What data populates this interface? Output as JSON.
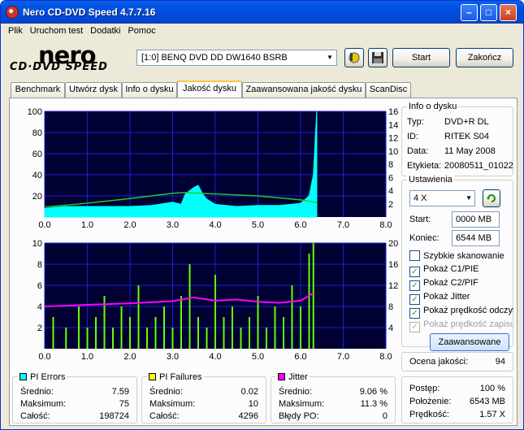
{
  "window": {
    "title": "Nero CD-DVD Speed 4.7.7.16"
  },
  "menu": [
    "Plik",
    "Uruchom test",
    "Dodatki",
    "Pomoc"
  ],
  "logo": {
    "brand": "nero",
    "product": "CD·DVD SPEED"
  },
  "drive": {
    "selected": "[1:0]  BENQ DVD DD DW1640 BSRB"
  },
  "buttons": {
    "start": "Start",
    "end": "Zakończ",
    "advanced": "Zaawansowane"
  },
  "tabs": [
    "Benchmark",
    "Utwórz dysk",
    "Info o dysku",
    "Jakość dysku",
    "Zaawansowana jakość dysku",
    "ScanDisc"
  ],
  "active_tab": "Jakość dysku",
  "disc_info": {
    "legend": "Info o dysku",
    "type_label": "Typ:",
    "type": "DVD+R DL",
    "id_label": "ID:",
    "id": "RITEK S04",
    "date_label": "Data:",
    "date": "11 May 2008",
    "label_label": "Etykieta:",
    "label": "20080511_01022"
  },
  "settings": {
    "legend": "Ustawienia",
    "speed": "4 X",
    "start_label": "Start:",
    "start": "0000 MB",
    "end_label": "Koniec:",
    "end": "6544 MB",
    "checks": [
      {
        "label": "Szybkie skanowanie",
        "checked": false,
        "enabled": true
      },
      {
        "label": "Pokaż C1/PIE",
        "checked": true,
        "enabled": true
      },
      {
        "label": "Pokaż C2/PIF",
        "checked": true,
        "enabled": true
      },
      {
        "label": "Pokaż Jitter",
        "checked": true,
        "enabled": true
      },
      {
        "label": "Pokaż prędkość odczytu",
        "checked": true,
        "enabled": true
      },
      {
        "label": "Pokaż prędkość zapisu",
        "checked": true,
        "enabled": false
      }
    ]
  },
  "quality": {
    "label": "Ocena jakości:",
    "value": "94"
  },
  "progress": {
    "progress_label": "Postęp:",
    "progress": "100 %",
    "position_label": "Położenie:",
    "position": "6543 MB",
    "speed_label": "Prędkość:",
    "speed": "1.57 X"
  },
  "stats": {
    "pi_errors": {
      "title": "PI Errors",
      "avg_label": "Średnio:",
      "avg": "7.59",
      "max_label": "Maksimum:",
      "max": "75",
      "total_label": "Całość:",
      "total": "198724"
    },
    "pi_failures": {
      "title": "PI Failures",
      "avg_label": "Średnio:",
      "avg": "0.02",
      "max_label": "Maksimum:",
      "max": "10",
      "total_label": "Całość:",
      "total": "4296"
    },
    "jitter": {
      "title": "Jitter",
      "avg_label": "Średnio:",
      "avg": "9.06 %",
      "max_label": "Maksimum:",
      "max": "11.3 %",
      "po_label": "Błędy PO:",
      "po": "0"
    }
  },
  "colors": {
    "pie": "#00ffff",
    "pif": "#ffff00",
    "jitter": "#ff00ff",
    "speed": "#22cc22",
    "pif_bars": "#66ff00",
    "plot_bg": "#000033",
    "grid": "#1d1dd8"
  },
  "chart_data": [
    {
      "type": "area",
      "title": "PI Errors",
      "x_ticks": [
        "0.0",
        "1.0",
        "2.0",
        "3.0",
        "4.0",
        "5.0",
        "6.0",
        "7.0",
        "8.0"
      ],
      "y_left_ticks": [
        "20",
        "40",
        "60",
        "80",
        "100"
      ],
      "y_right_ticks": [
        "2",
        "4",
        "6",
        "8",
        "10",
        "12",
        "14",
        "16"
      ],
      "xlim": [
        0,
        8
      ],
      "ylim": [
        0,
        100
      ],
      "y2lim": [
        0,
        16
      ],
      "series": [
        {
          "values_x": [
            0,
            0.2,
            0.5,
            1.0,
            1.5,
            2.0,
            2.5,
            3.0,
            3.2,
            3.3,
            3.4,
            3.5,
            3.6,
            3.7,
            3.8,
            4.0,
            4.5,
            5.0,
            5.5,
            6.0,
            6.2,
            6.3,
            6.35,
            6.38
          ],
          "values": [
            8,
            9,
            10,
            10,
            10,
            10,
            11,
            14,
            12,
            22,
            25,
            28,
            30,
            22,
            17,
            12,
            10,
            11,
            11,
            13,
            20,
            40,
            80,
            100
          ]
        },
        {
          "values_x": [
            0,
            1,
            2,
            3,
            3.3,
            4,
            5,
            6,
            6.38
          ],
          "values": [
            1.5,
            2.1,
            2.8,
            3.6,
            3.7,
            3.5,
            3.2,
            2.6,
            2.2
          ]
        }
      ]
    },
    {
      "type": "bar",
      "title": "PI Failures",
      "x_ticks": [
        "0.0",
        "1.0",
        "2.0",
        "3.0",
        "4.0",
        "5.0",
        "6.0",
        "7.0",
        "8.0"
      ],
      "y_left_ticks": [
        "2",
        "4",
        "6",
        "8",
        "10"
      ],
      "y_right_ticks": [
        "4",
        "8",
        "12",
        "16",
        "20"
      ],
      "xlim": [
        0,
        8
      ],
      "ylim": [
        0,
        10
      ],
      "y2lim": [
        0,
        20
      ],
      "series": [
        {
          "values_x": [
            0.2,
            0.5,
            0.8,
            1.0,
            1.2,
            1.4,
            1.6,
            1.8,
            2.0,
            2.2,
            2.4,
            2.6,
            2.8,
            3.0,
            3.2,
            3.4,
            3.6,
            3.8,
            4.0,
            4.2,
            4.4,
            4.6,
            4.8,
            5.0,
            5.2,
            5.4,
            5.6,
            5.8,
            6.0,
            6.2,
            6.3
          ],
          "values": [
            3,
            2,
            4,
            2,
            3,
            5,
            2,
            4,
            3,
            6,
            2,
            3,
            4,
            2,
            5,
            8,
            3,
            2,
            7,
            3,
            4,
            2,
            3,
            5,
            2,
            4,
            3,
            6,
            4,
            9,
            10
          ]
        },
        {
          "values_x": [
            0,
            1,
            2,
            3,
            3.5,
            4,
            4.5,
            5,
            5.5,
            6,
            6.3
          ],
          "values": [
            8,
            8.3,
            8.6,
            9,
            9.7,
            9.1,
            9.3,
            8.9,
            8.7,
            9.1,
            10.5
          ]
        }
      ]
    }
  ]
}
